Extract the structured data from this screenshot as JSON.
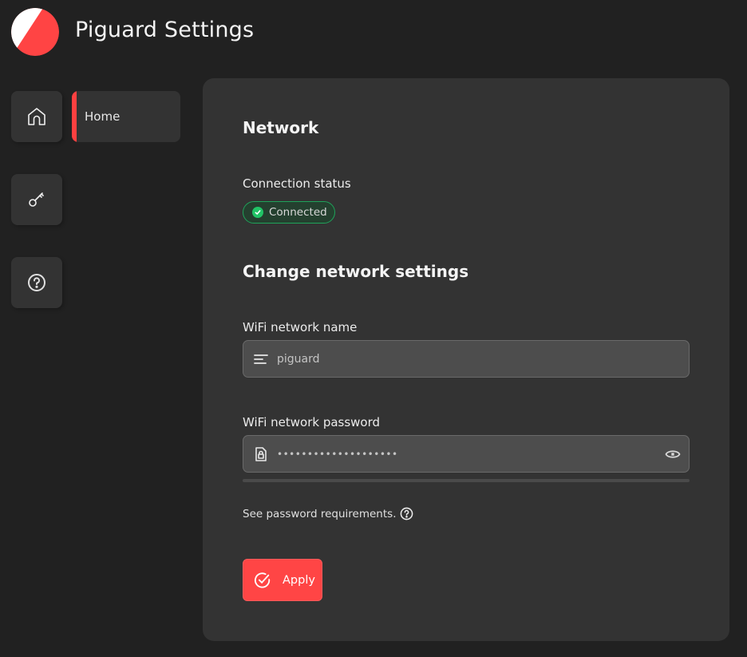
{
  "header": {
    "title": "Piguard Settings",
    "logo_colors": {
      "primary": "#ff4444",
      "secondary": "#ffffff"
    }
  },
  "sidebar": {
    "items": [
      {
        "icon": "home-icon",
        "label": "Home",
        "active": true
      },
      {
        "icon": "key-icon",
        "label": ""
      },
      {
        "icon": "help-icon",
        "label": ""
      }
    ],
    "active_label": "Home",
    "accent_color": "#ff4040"
  },
  "network": {
    "heading": "Network",
    "status_label": "Connection status",
    "status_value": "Connected",
    "status_color": "#20c466"
  },
  "change_settings": {
    "heading": "Change network settings",
    "ssid_label": "WiFi network name",
    "ssid_value": "piguard",
    "password_label": "WiFi network password",
    "password_value": "••••••••••••••••••••",
    "requirements_text": "See password requirements.",
    "apply_label": "Apply",
    "apply_color": "#ff4545"
  }
}
